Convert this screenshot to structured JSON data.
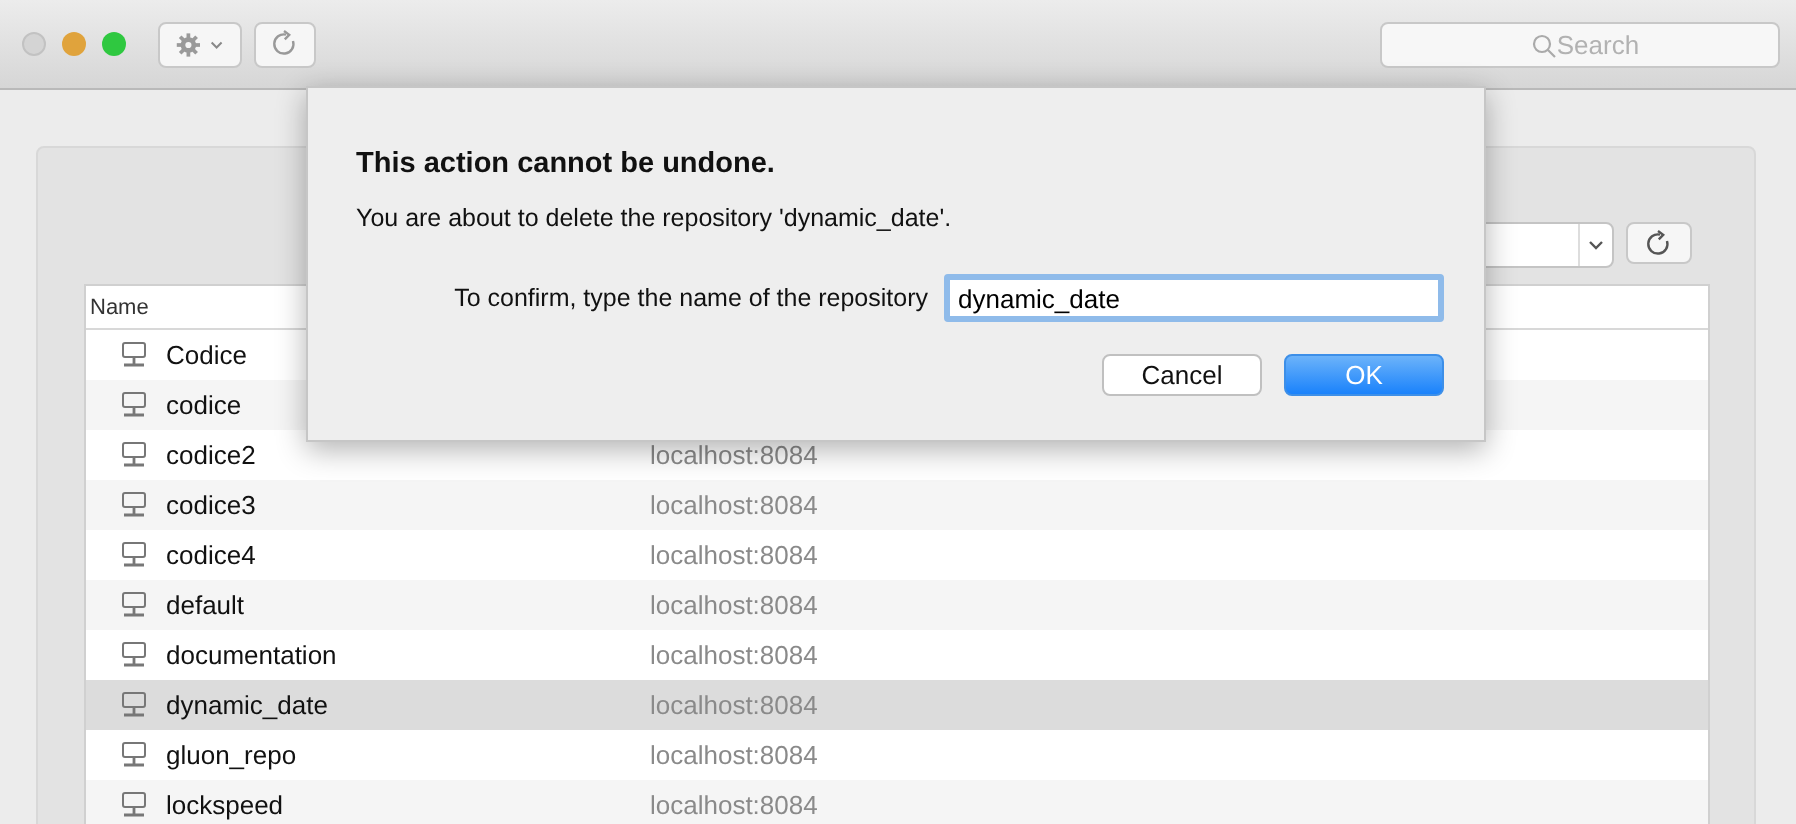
{
  "window": {
    "buttons": [
      {
        "kind": "close",
        "disabled": true
      },
      {
        "kind": "minimize",
        "disabled": false
      },
      {
        "kind": "zoom",
        "disabled": false
      }
    ]
  },
  "toolbar": {
    "search": {
      "placeholder": "Search"
    }
  },
  "table": {
    "columns": [
      "Name"
    ],
    "rows": [
      {
        "name": "Codice",
        "selected": false
      },
      {
        "name": "codice",
        "selected": false
      },
      {
        "name": "codice2",
        "server": "localhost:8084",
        "selected": false
      },
      {
        "name": "codice3",
        "server": "localhost:8084",
        "selected": false
      },
      {
        "name": "codice4",
        "server": "localhost:8084",
        "selected": false
      },
      {
        "name": "default",
        "server": "localhost:8084",
        "selected": false
      },
      {
        "name": "documentation",
        "server": "localhost:8084",
        "selected": false
      },
      {
        "name": "dynamic_date",
        "server": "localhost:8084",
        "selected": true
      },
      {
        "name": "gluon_repo",
        "server": "localhost:8084",
        "selected": false
      },
      {
        "name": "lockspeed",
        "server": "localhost:8084",
        "selected": false
      }
    ]
  },
  "dialog": {
    "title": "This action cannot be undone.",
    "message": "You are about to delete the repository 'dynamic_date'.",
    "field_label": "To confirm, type the name of the repository",
    "field_value": "dynamic_date",
    "buttons": [
      {
        "label": "Cancel",
        "default": false
      },
      {
        "label": "OK",
        "default": true
      }
    ]
  }
}
